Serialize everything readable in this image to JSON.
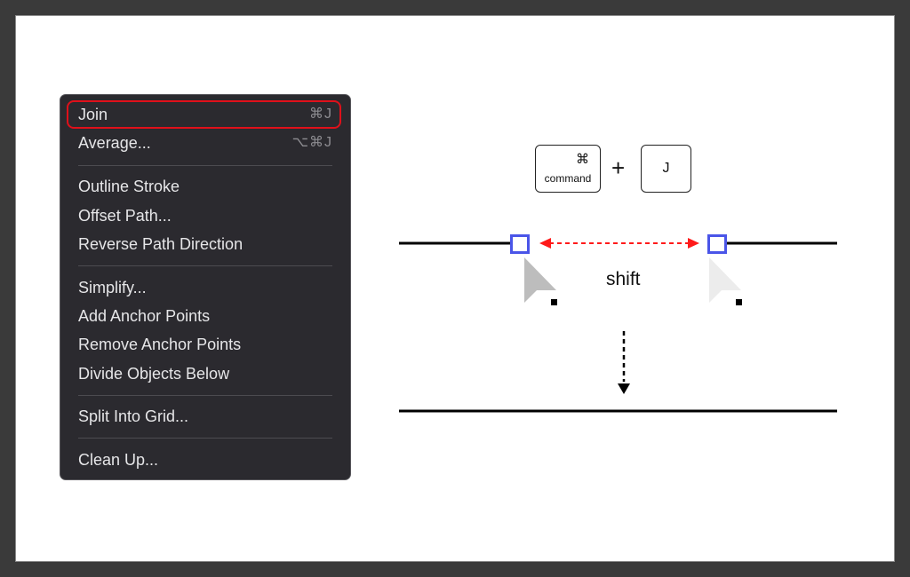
{
  "menu": {
    "highlighted_index": 0,
    "items": [
      {
        "label": "Join",
        "shortcut": "⌘J"
      },
      {
        "label": "Average...",
        "shortcut": "⌥⌘J"
      },
      {
        "label": "Outline Stroke",
        "shortcut": ""
      },
      {
        "label": "Offset Path...",
        "shortcut": ""
      },
      {
        "label": "Reverse Path Direction",
        "shortcut": ""
      },
      {
        "label": "Simplify...",
        "shortcut": ""
      },
      {
        "label": "Add Anchor Points",
        "shortcut": ""
      },
      {
        "label": "Remove Anchor Points",
        "shortcut": ""
      },
      {
        "label": "Divide Objects Below",
        "shortcut": ""
      },
      {
        "label": "Split Into Grid...",
        "shortcut": ""
      },
      {
        "label": "Clean Up...",
        "shortcut": ""
      }
    ]
  },
  "diagram": {
    "keys": {
      "command_symbol": "⌘",
      "command_label": "command",
      "plus": "+",
      "second_key": "J"
    },
    "modifier_label": "shift",
    "colors": {
      "highlight_border": "#e0101a",
      "anchor": "#4a55e8",
      "arrow_red": "#ff1a1a",
      "cursor_dark": "#bdbdbd",
      "cursor_light": "#ececec"
    }
  }
}
